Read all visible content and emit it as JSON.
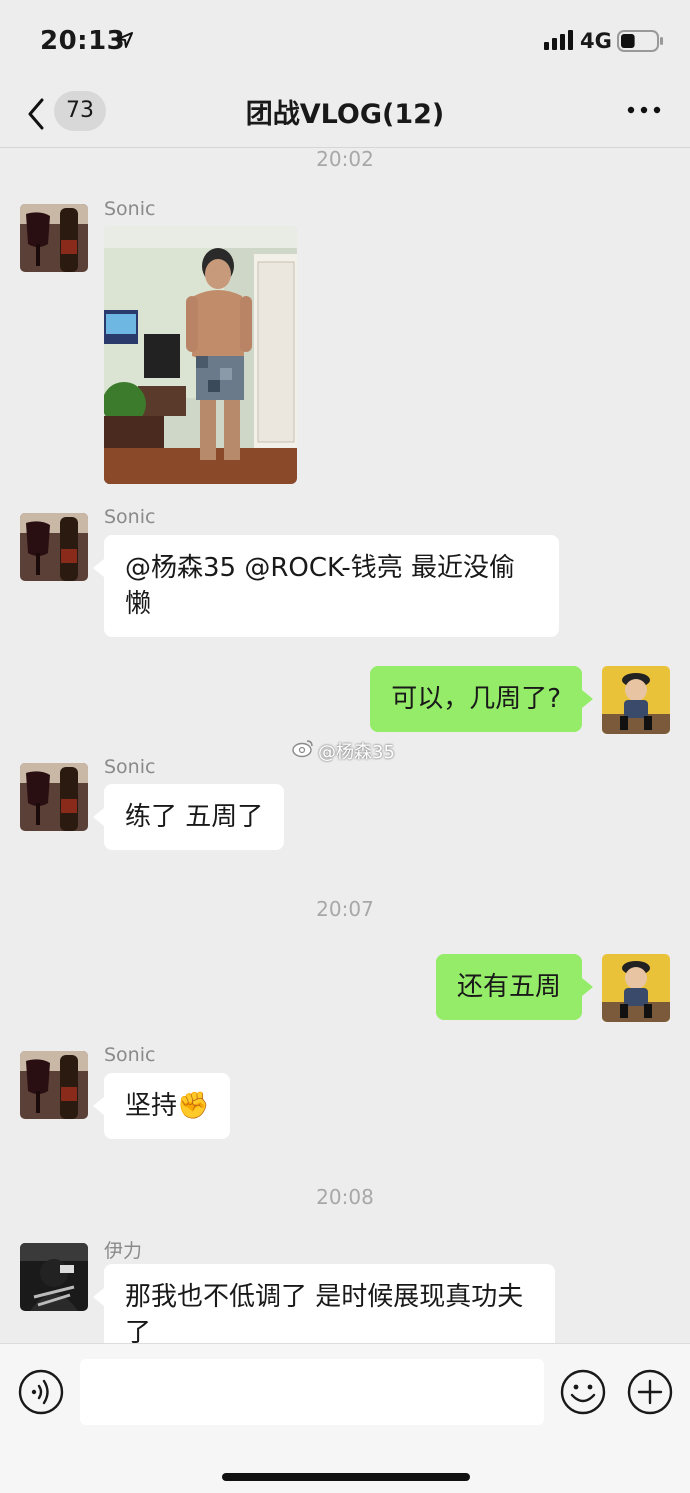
{
  "status_bar": {
    "time": "20:13",
    "network": "4G",
    "battery_level_percent": 40
  },
  "header": {
    "unread_count": "73",
    "title": "团战VLOG(12)"
  },
  "timestamps": [
    "20:02",
    "20:07",
    "20:08"
  ],
  "messages": [
    {
      "sender": "Sonic",
      "type": "image"
    },
    {
      "sender": "Sonic",
      "text": "@杨森35 @ROCK-钱亮 最近没偷懒"
    },
    {
      "sender": "me",
      "text": "可以，几周了?"
    },
    {
      "sender": "Sonic",
      "text": "练了 五周了"
    },
    {
      "sender": "me",
      "text": "还有五周"
    },
    {
      "sender": "Sonic",
      "text": "坚持",
      "emoji": "✊"
    },
    {
      "sender": "伊力",
      "text": "那我也不低调了 是时候展现真功夫了"
    }
  ],
  "watermark": "@杨森35",
  "input": {
    "placeholder": ""
  },
  "colors": {
    "background": "#ededed",
    "sent_bubble": "#95ec69",
    "received_bubble": "#ffffff"
  }
}
